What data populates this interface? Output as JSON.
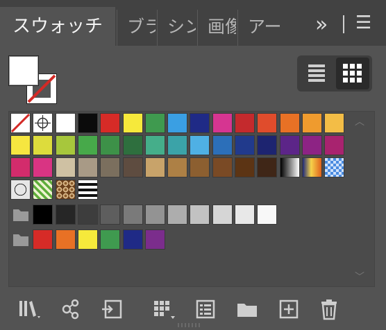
{
  "tabs": [
    {
      "label": "スウォッチ",
      "active": true
    },
    {
      "label": "ブラ",
      "active": false
    },
    {
      "label": "シン",
      "active": false
    },
    {
      "label": "画像",
      "active": false
    },
    {
      "label": "アー",
      "active": false
    }
  ],
  "tab_controls": {
    "overflow": "»",
    "menu": "☰"
  },
  "colors": {
    "panel_bg": "#535353",
    "tabbar_bg": "#424242",
    "grid_bg": "#4b4b4b"
  },
  "swatch_rows": [
    [
      "none",
      "registration",
      "#ffffff",
      "#0b0b0b",
      "#d62b27",
      "#f6e93b",
      "#3f9a4f",
      "#3a9fe3",
      "#1f2a86",
      "#d63591",
      "#c42a2d",
      "#e04c2c",
      "#e87125",
      "#ef9b2e",
      "#f3bd46"
    ],
    [
      "#f6e640",
      "#dddc3c",
      "#a7c73c",
      "#47a94a",
      "#3d9148",
      "#2e6f3e",
      "#45ae8a",
      "#3ba3a8",
      "#4fb0e4",
      "#2c6fb9",
      "#213a8c",
      "#1d2470",
      "#5c2588",
      "#8d2384",
      "#a8236f"
    ],
    [
      "#d32c6c",
      "#d93483",
      "#cfc1a3",
      "#a89a86",
      "#7b6f5e",
      "#5e4c40",
      "#c8a36a",
      "#ad8045",
      "#8c5f30",
      "#7a4a25",
      "#5c3414",
      "#3f2617",
      "gradient-bw",
      "gradient-orange",
      "gradient-blue"
    ],
    [
      "pattern-dots",
      "pattern-leaf",
      "pattern-floral",
      "pattern-stripes"
    ],
    [
      "folder",
      "#000000",
      "#262626",
      "#3d3d3d",
      "#5e5e5e",
      "#7a7a7a",
      "#939393",
      "#adadad",
      "#c2c2c2",
      "#d6d6d6",
      "#e8e8e8",
      "#f8f8f8"
    ],
    [
      "folder",
      "#d62b27",
      "#e87125",
      "#f6e93b",
      "#3f9a4f",
      "#1f2a86",
      "#7b2d8c"
    ]
  ],
  "toolbar_icons": [
    "swatch-libraries-icon",
    "color-group-icon",
    "place-swatch-icon",
    "swatch-options-icon",
    "swatch-options-list-icon",
    "new-color-group-icon",
    "new-swatch-icon",
    "delete-swatch-icon"
  ]
}
